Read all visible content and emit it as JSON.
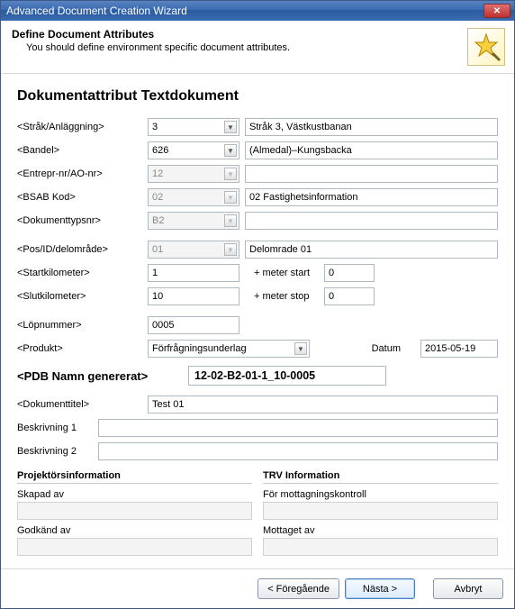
{
  "window": {
    "title": "Advanced Document Creation Wizard"
  },
  "header": {
    "title": "Define Document Attributes",
    "subtitle": "You should define environment specific document attributes."
  },
  "page_heading": "Dokumentattribut Textdokument",
  "labels": {
    "strak": "<Stråk/Anläggning>",
    "bandel": "<Bandel>",
    "entrepr": "<Entrepr-nr/AO-nr>",
    "bsab": "<BSAB Kod>",
    "doktyp": "<Dokumenttypsnr>",
    "pos": "<Pos/ID/delområde>",
    "startkm": "<Startkilometer>",
    "slutkm": "<Slutkilometer>",
    "lopnr": "<Löpnummer>",
    "produkt": "<Produkt>",
    "datum": "Datum",
    "meter_start": "+ meter start",
    "meter_stop": "+ meter stop",
    "pdb": "<PDB Namn genererat>",
    "dokumenttitel": "<Dokumenttitel>",
    "beskr1": "Beskrivning 1",
    "beskr2": "Beskrivning 2",
    "proj_info": "Projektörsinformation",
    "trv_info": "TRV Information",
    "skapad_av": "Skapad av",
    "godkand_av": "Godkänd av",
    "mottagn": "För mottagningskontroll",
    "mottaget": "Mottaget av"
  },
  "values": {
    "strak": "3",
    "strak_desc": "Stråk 3, Västkustbanan",
    "bandel": "626",
    "bandel_desc": "(Almedal)–Kungsbacka",
    "entrepr": "12",
    "entrepr_desc": "",
    "bsab": "02",
    "bsab_desc": "02 Fastighetsinformation",
    "doktyp": "B2",
    "doktyp_desc": "",
    "pos": "01",
    "pos_desc": "Delomrade 01",
    "startkm": "1",
    "meter_start": "0",
    "slutkm": "10",
    "meter_stop": "0",
    "lopnr": "0005",
    "produkt": "Förfrågningsunderlag",
    "datum": "2015-05-19",
    "pdb": "12-02-B2-01-1_10-0005",
    "dokumenttitel": "Test 01",
    "beskr1": "",
    "beskr2": ""
  },
  "footer": {
    "prev": "< Föregående",
    "next": "Nästa >",
    "cancel": "Avbryt"
  }
}
